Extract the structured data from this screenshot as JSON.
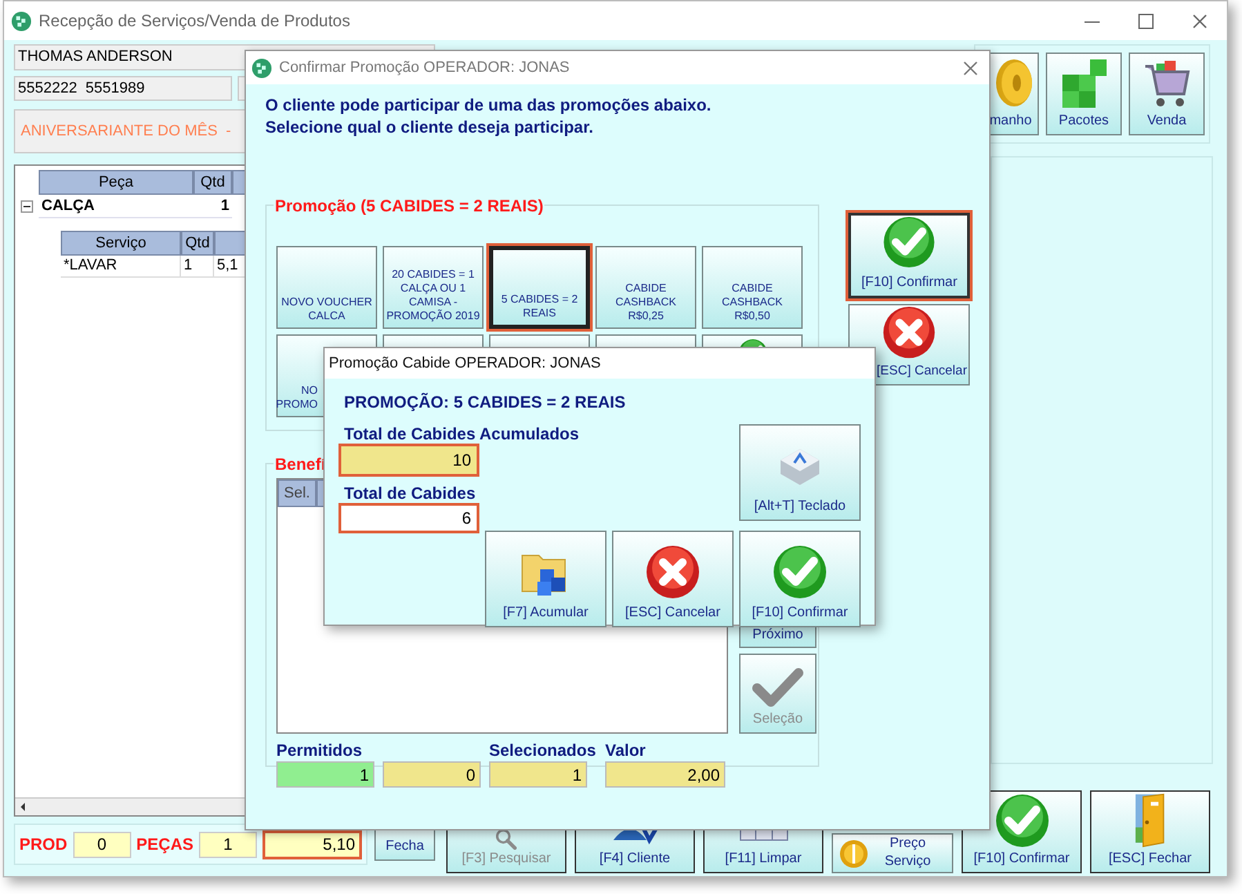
{
  "window": {
    "title": "Recepção de Serviços/Venda de Produtos"
  },
  "customer": {
    "name": "THOMAS ANDERSON",
    "phones": "5552222  5551989",
    "birthday_notice": "ANIVERSARIANTE DO MÊS  -"
  },
  "products_grid": {
    "columns": [
      "Peça",
      "Qtd"
    ],
    "rows": [
      {
        "name": "CALÇA",
        "qty": "1",
        "expanded": true,
        "services": {
          "columns": [
            "Serviço",
            "Qtd"
          ],
          "rows": [
            {
              "name": "*LAVAR",
              "qty": "1",
              "column_3": "5,1"
            }
          ]
        }
      }
    ]
  },
  "totals": {
    "prod_label": "PROD",
    "prod": "0",
    "pieces_label": "PEÇAS",
    "pieces": "1",
    "amount": "5,10"
  },
  "close_button": "Fecha",
  "top_buttons": [
    {
      "label": "manho"
    },
    {
      "label": "Pacotes"
    },
    {
      "label": "Venda"
    }
  ],
  "toolbar": [
    {
      "label": "[F3] Pesquisar",
      "kind": "large",
      "disabled": true
    },
    {
      "label": "[F4] Cliente",
      "kind": "large",
      "disabled": false
    },
    {
      "label": "[F11] Limpar",
      "kind": "large",
      "disabled": false
    },
    {
      "label": "Preço Serviço",
      "kind": "small",
      "disabled": false
    },
    {
      "label": "[F10] Confirmar",
      "kind": "large",
      "disabled": false
    },
    {
      "label": "[ESC] Fechar",
      "kind": "large",
      "disabled": false
    }
  ],
  "promo_dialog": {
    "title": "Confirmar Promoção OPERADOR: JONAS",
    "message": [
      "O cliente pode participar de uma das promoções abaixo.",
      "Selecione qual o cliente deseja participar."
    ],
    "group_title": "Promoção (5 CABIDES = 2 REAIS)",
    "promotions": [
      {
        "lines": [
          "NOVO VOUCHER",
          "CALCA"
        ],
        "selected": false
      },
      {
        "lines": [
          "20 CABIDES = 1",
          "CALÇA OU 1",
          "CAMISA -",
          "PROMOÇÃO 2019"
        ],
        "selected": false
      },
      {
        "lines": [
          "5 CABIDES = 2",
          "REAIS"
        ],
        "selected": true
      },
      {
        "lines": [
          "CABIDE",
          "CASHBACK",
          "R$0,25"
        ],
        "selected": false
      },
      {
        "lines": [
          "CABIDE",
          "CASHBACK",
          "R$0,50"
        ],
        "selected": false
      },
      {
        "lines": [
          "NO",
          "PROMO"
        ],
        "selected": false
      },
      {
        "selected": false
      },
      {
        "selected": false
      },
      {
        "selected": false
      },
      {
        "selected": false
      }
    ],
    "confirm_button": "[F10] Confirmar",
    "cancel_button": "[ESC] Cancelar",
    "benefits_title": "Benefí",
    "benefits_columns": [
      "Sel."
    ],
    "next_button": "Próximo",
    "select_button": {
      "label": "Seleção",
      "disabled": true
    },
    "counters": [
      {
        "label": "Permitidos",
        "value": "1",
        "color": "#90ee90"
      },
      {
        "value": "0",
        "color": "#f0e68c"
      },
      {
        "label": "Selecionados",
        "value": "1",
        "color": "#f0e68c"
      },
      {
        "label": "Valor",
        "value": "2,00",
        "color": "#f0e68c"
      }
    ]
  },
  "cabide_dialog": {
    "title": "Promoção Cabide OPERADOR: JONAS",
    "heading": "PROMOÇÃO: 5 CABIDES = 2 REAIS",
    "accumulated_label": "Total de Cabides Acumulados",
    "accumulated": "10",
    "total_label": "Total de Cabides",
    "total": "6",
    "keyboard_button": "[Alt+T] Teclado",
    "buttons": [
      {
        "label": "[F7] Acumular"
      },
      {
        "label": "[ESC] Cancelar"
      },
      {
        "label": "[F10] Confirmar"
      }
    ]
  }
}
